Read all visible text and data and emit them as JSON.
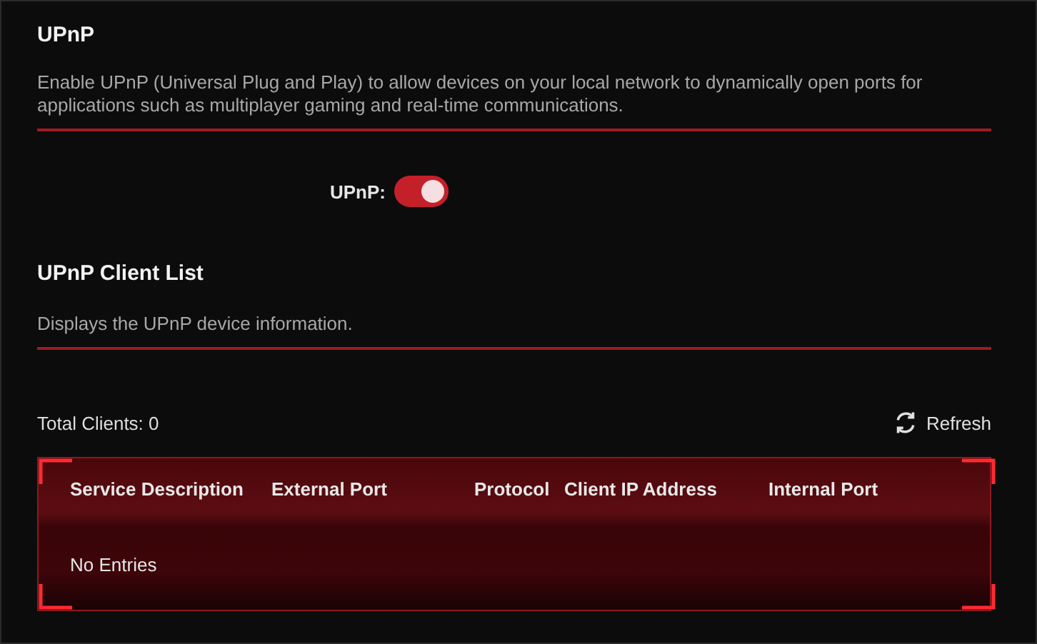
{
  "upnp": {
    "title": "UPnP",
    "description": "Enable UPnP (Universal Plug and Play) to allow devices on your local network to dynamically open ports for applications such as multiplayer gaming and real-time communications.",
    "toggle": {
      "label": "UPnP:",
      "on": true
    }
  },
  "client_list": {
    "title": "UPnP Client List",
    "description": "Displays the UPnP device information.",
    "total": "Total Clients: 0",
    "refresh": "Refresh",
    "table": {
      "columns": [
        "Service Description",
        "External Port",
        "Protocol",
        "Client IP Address",
        "Internal Port"
      ],
      "empty": "No Entries"
    }
  }
}
